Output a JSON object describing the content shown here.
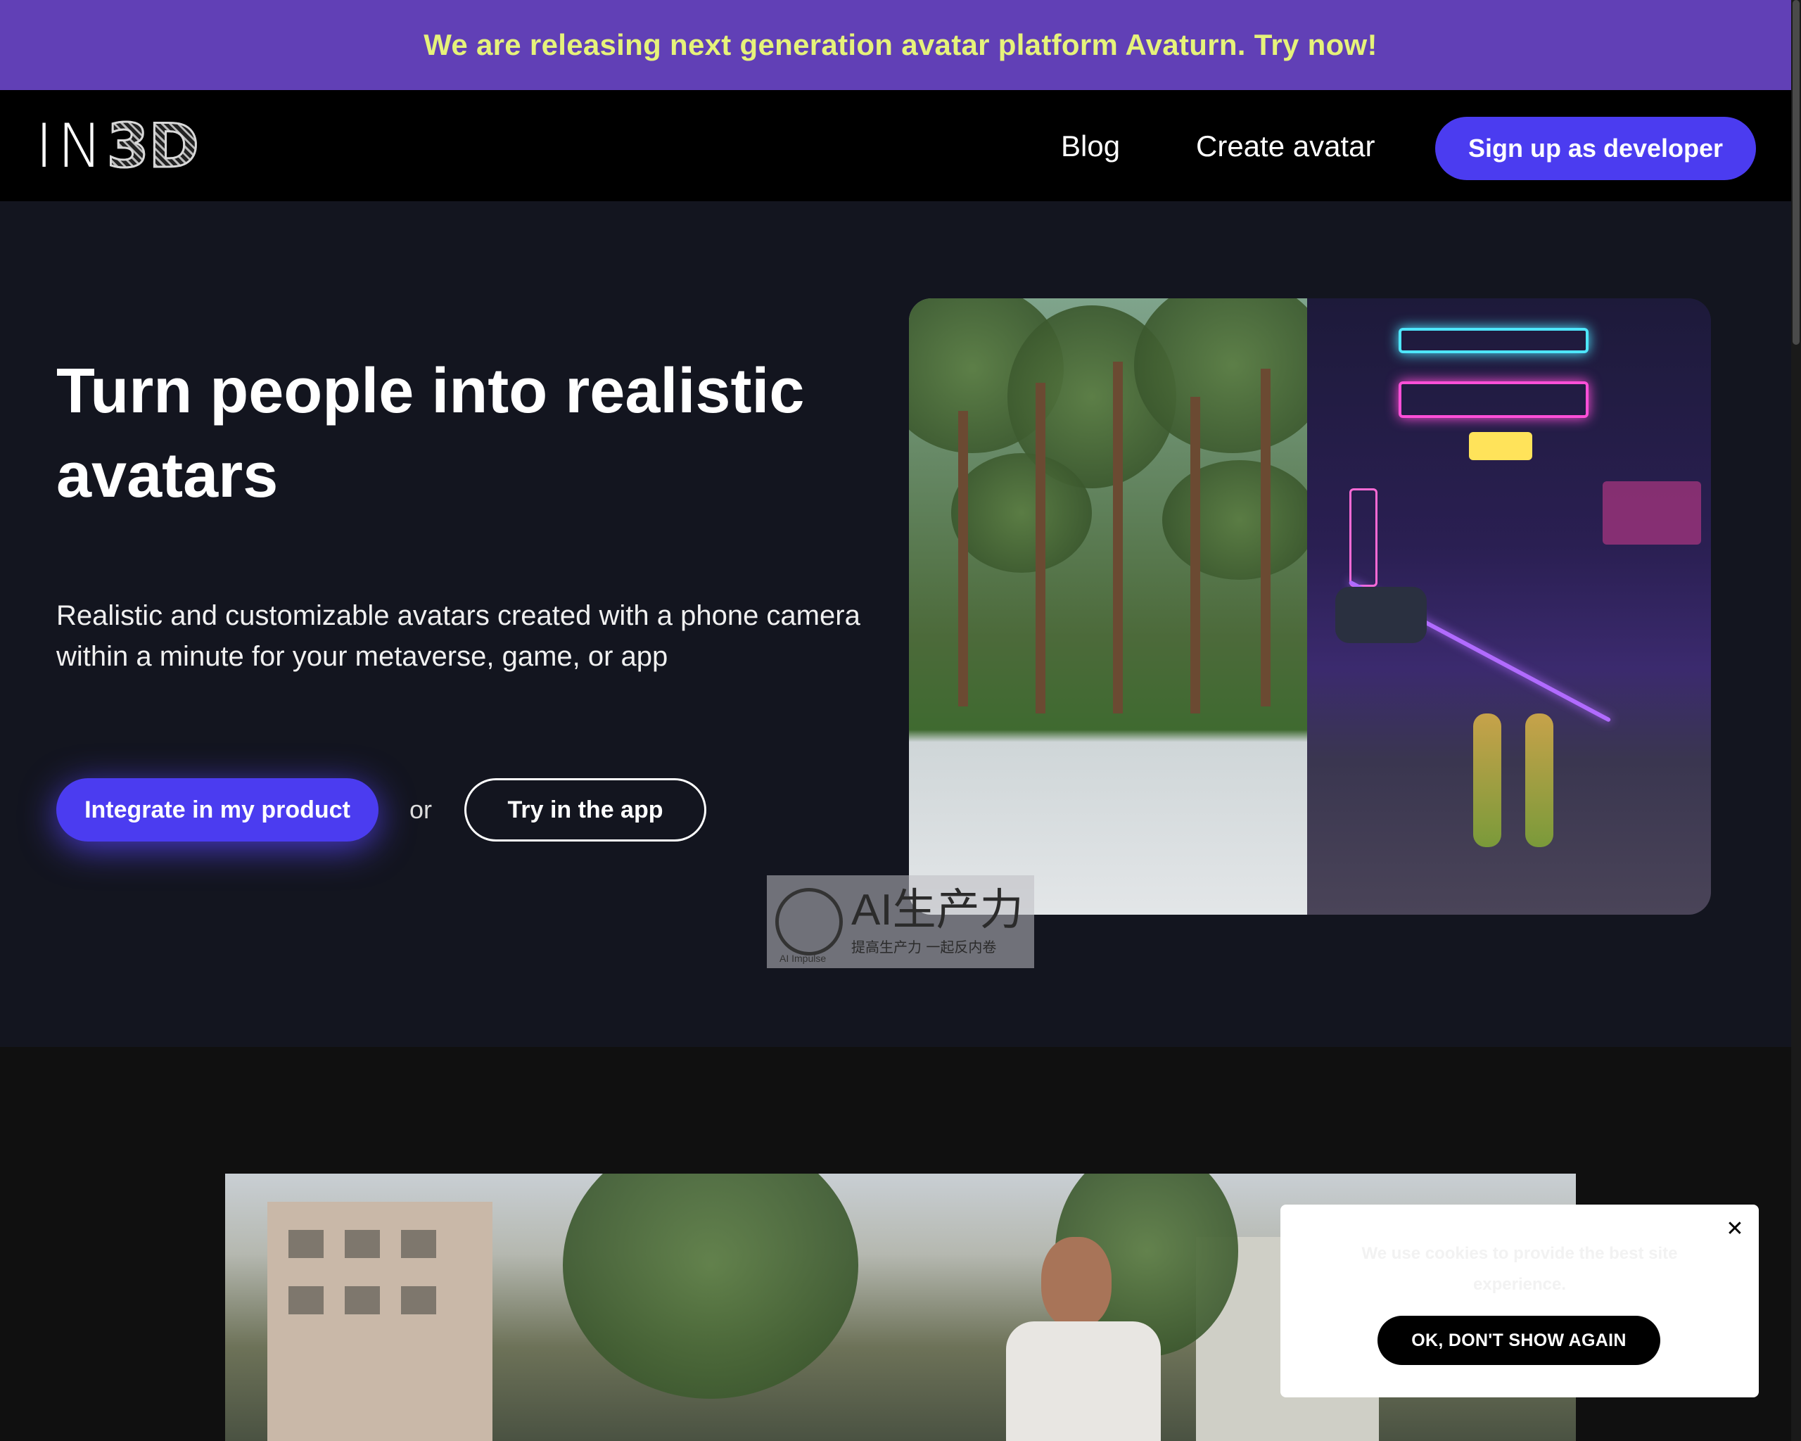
{
  "banner": {
    "text": "We are releasing next generation avatar platform Avaturn. Try now!"
  },
  "header": {
    "logo_in": "IN",
    "logo_3d": "3D",
    "nav": {
      "blog": "Blog",
      "create_avatar": "Create avatar"
    },
    "developer_button": "Sign up as developer"
  },
  "hero": {
    "title": "Turn people into realistic avatars",
    "subtitle": "Realistic and customizable avatars created with a phone camera within a minute for your metaverse, game, or app",
    "integrate_button": "Integrate in my product",
    "or_text": "or",
    "try_button": "Try in the app"
  },
  "watermark": {
    "main": "AI生产力",
    "sub": "提高生产力 一起反内卷",
    "label": "AI Impulse"
  },
  "cookie": {
    "text": "We use cookies to provide the best site experience.",
    "close_icon": "close-icon",
    "ok_button": "OK, DON'T SHOW AGAIN"
  },
  "colors": {
    "banner_bg": "#6140b6",
    "banner_text": "#e6f27a",
    "accent": "#4b3cf0",
    "hero_bg": "#13151f",
    "header_bg": "#000000"
  }
}
